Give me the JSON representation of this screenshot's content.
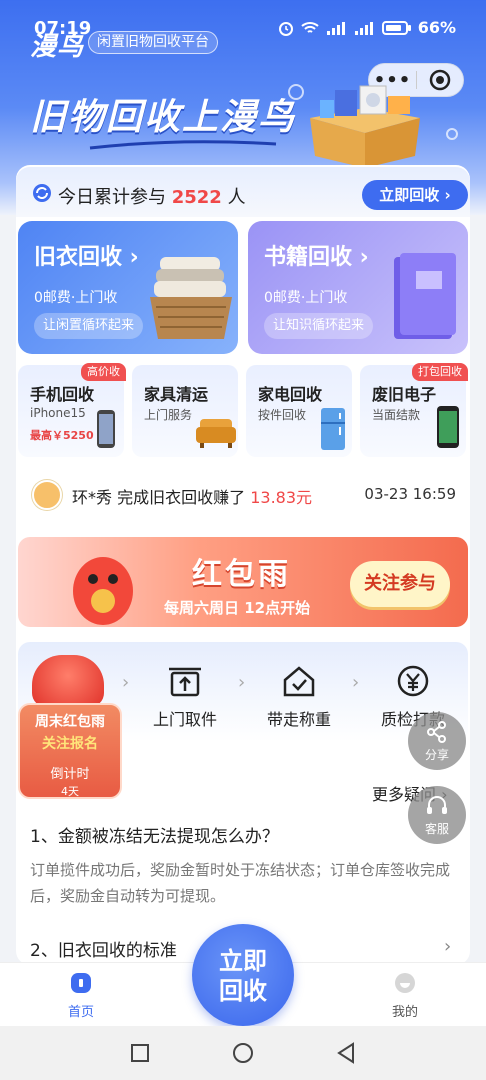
{
  "status": {
    "time": "07:19",
    "battery": "66%"
  },
  "header": {
    "logo": "漫鸟",
    "platform": "闲置旧物回收平台",
    "slogan": "旧物回收上漫鸟"
  },
  "counter": {
    "prefix": "今日累计参与",
    "count": "2522",
    "suffix": "人",
    "button": "立即回收 ›"
  },
  "big_cards": [
    {
      "title": "旧衣回收 ›",
      "sub": "0邮费·上门收",
      "pill": "让闲置循环起来"
    },
    {
      "title": "书籍回收 ›",
      "sub": "0邮费·上门收",
      "pill": "让知识循环起来"
    }
  ],
  "small_cards": [
    {
      "title": "手机回收",
      "sub": "iPhone15",
      "price": "最高￥5250",
      "tag": "高价收"
    },
    {
      "title": "家具清运",
      "sub": "上门服务"
    },
    {
      "title": "家电回收",
      "sub": "按件回收"
    },
    {
      "title": "废旧电子",
      "sub": "当面结款",
      "tag": "打包回收"
    }
  ],
  "notice": {
    "user": "环*秀",
    "text": "完成旧衣回收赚了",
    "amount": "13.83元",
    "time": "03-23 16:59"
  },
  "banner": {
    "title": "红包雨",
    "sub": "每周六周日 12点开始",
    "button": "关注参与"
  },
  "steps": [
    {
      "label": "上门取件"
    },
    {
      "label": "带走称重"
    },
    {
      "label": "质检打款"
    }
  ],
  "promo": {
    "line1": "周末红包雨",
    "line2": "关注报名",
    "line3": "倒计时",
    "line4": "4天"
  },
  "floats": {
    "share": "分享",
    "service": "客服"
  },
  "faq": {
    "more": "更多疑问 ›",
    "q1": "1、金额被冻结无法提现怎么办？",
    "a1": "订单揽件成功后，奖励金暂时处于冻结状态；订单仓库签收完成后，奖励金自动转为可提现。",
    "q2": "2、旧衣回收的标准"
  },
  "tabbar": {
    "home": "首页",
    "fab": "立即回收",
    "mine": "我的"
  },
  "colors": {
    "primary": "#3e6cf0",
    "accent": "#f04848"
  }
}
